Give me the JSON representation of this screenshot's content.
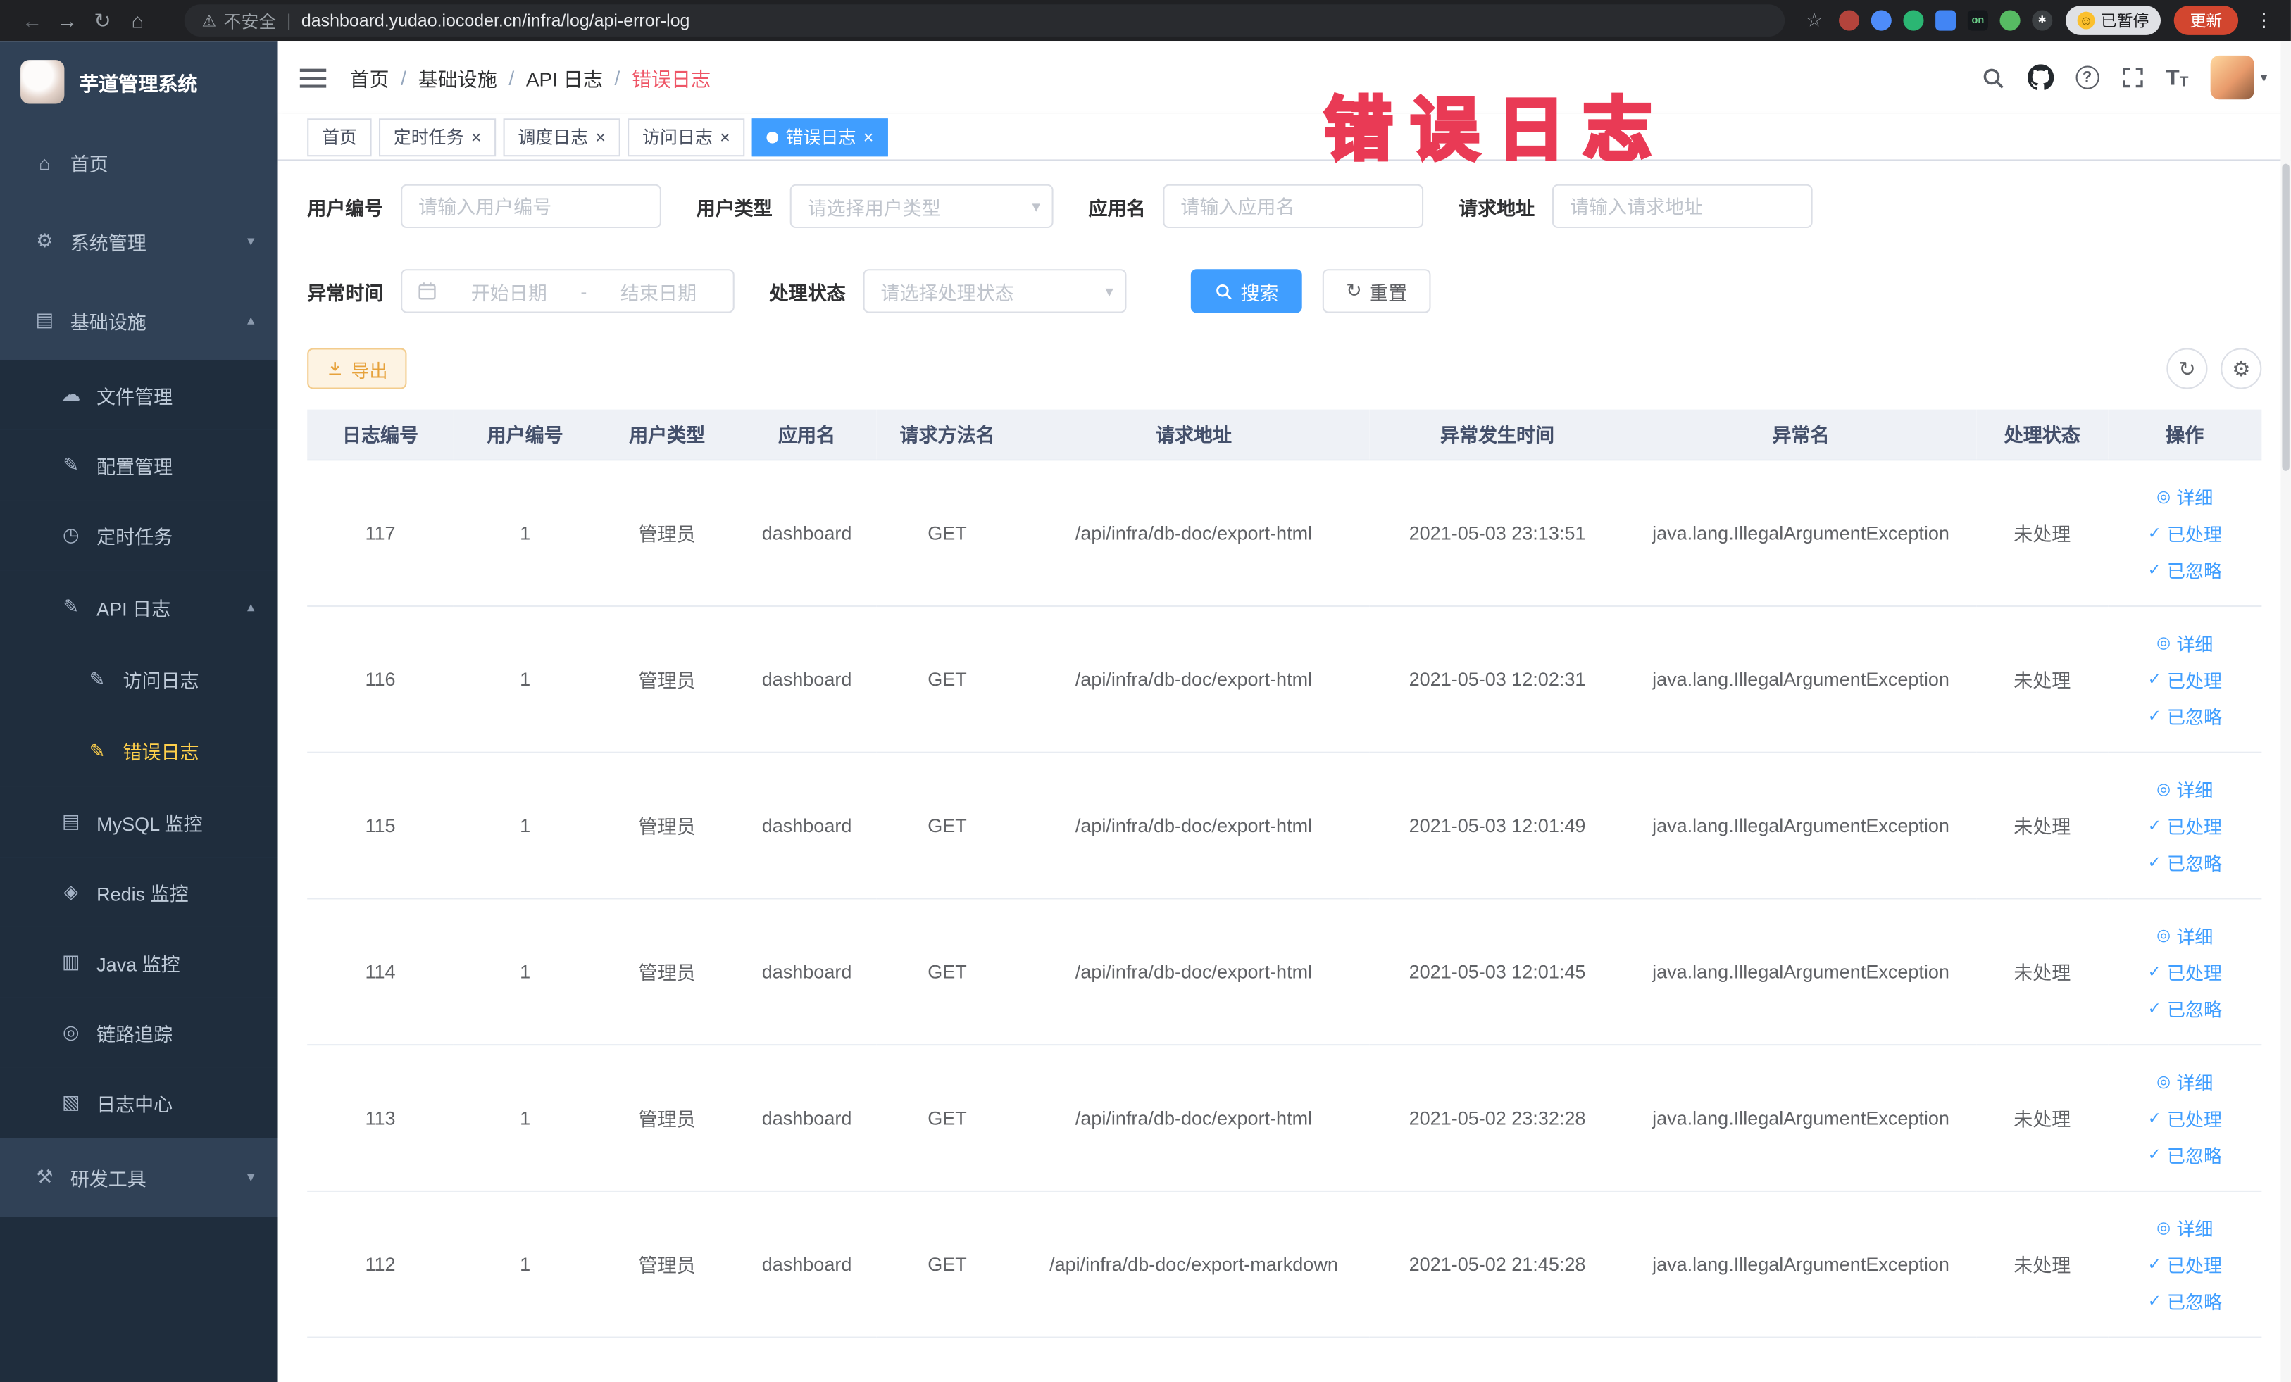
{
  "browser": {
    "security_label": "不安全",
    "url": "dashboard.yudao.iocoder.cn/infra/log/api-error-log",
    "paused_badge": "已暂停",
    "update_button": "更新",
    "extensions": [
      {
        "name": "extension-red-circle-icon",
        "shape": "circle",
        "color": "#b3443c",
        "text": ""
      },
      {
        "name": "extension-blue-drop-icon",
        "shape": "circle",
        "color": "#4e8cf9",
        "text": ""
      },
      {
        "name": "extension-green-circle-icon",
        "shape": "circle",
        "color": "#2bb673",
        "text": ""
      },
      {
        "name": "extension-blue-grid-icon",
        "shape": "square",
        "color": "#4285f4",
        "text": ""
      },
      {
        "name": "extension-on-badge-icon",
        "shape": "square",
        "color": "#15181c",
        "text": "on"
      },
      {
        "name": "extension-green-leaf-icon",
        "shape": "circle",
        "color": "#57bb63",
        "text": ""
      },
      {
        "name": "extension-paw-icon",
        "shape": "circle",
        "color": "#3c4043",
        "text": "✱"
      }
    ]
  },
  "sidebar": {
    "title": "芋道管理系统",
    "items": [
      {
        "label": "首页"
      },
      {
        "label": "系统管理"
      },
      {
        "label": "基础设施",
        "children": [
          {
            "label": "文件管理"
          },
          {
            "label": "配置管理"
          },
          {
            "label": "定时任务"
          },
          {
            "label": "API 日志",
            "children": [
              {
                "label": "访问日志"
              },
              {
                "label": "错误日志",
                "active": true
              }
            ]
          },
          {
            "label": "MySQL 监控"
          },
          {
            "label": "Redis 监控"
          },
          {
            "label": "Java 监控"
          },
          {
            "label": "链路追踪"
          },
          {
            "label": "日志中心"
          }
        ]
      },
      {
        "label": "研发工具"
      }
    ]
  },
  "header": {
    "breadcrumb": [
      "首页",
      "基础设施",
      "API 日志",
      "错误日志"
    ]
  },
  "overlay_title": "错误日志",
  "tags": [
    {
      "label": "首页",
      "closable": false,
      "active": false
    },
    {
      "label": "定时任务",
      "closable": true,
      "active": false
    },
    {
      "label": "调度日志",
      "closable": true,
      "active": false
    },
    {
      "label": "访问日志",
      "closable": true,
      "active": false
    },
    {
      "label": "错误日志",
      "closable": true,
      "active": true
    }
  ],
  "filters": {
    "user_id": {
      "label": "用户编号",
      "placeholder": "请输入用户编号"
    },
    "user_type": {
      "label": "用户类型",
      "placeholder": "请选择用户类型"
    },
    "app_name": {
      "label": "应用名",
      "placeholder": "请输入应用名"
    },
    "request_url": {
      "label": "请求地址",
      "placeholder": "请输入请求地址"
    },
    "exception_time": {
      "label": "异常时间",
      "start_placeholder": "开始日期",
      "separator": "-",
      "end_placeholder": "结束日期"
    },
    "process_status": {
      "label": "处理状态",
      "placeholder": "请选择处理状态"
    },
    "search_label": "搜索",
    "reset_label": "重置"
  },
  "toolbar": {
    "export_label": "导出"
  },
  "table": {
    "columns": [
      "日志编号",
      "用户编号",
      "用户类型",
      "应用名",
      "请求方法名",
      "请求地址",
      "异常发生时间",
      "异常名",
      "处理状态",
      "操作"
    ],
    "row_actions": [
      "详细",
      "已处理",
      "已忽略"
    ],
    "rows": [
      {
        "id": "117",
        "user_id": "1",
        "user_type": "管理员",
        "app": "dashboard",
        "method": "GET",
        "url": "/api/infra/db-doc/export-html",
        "time": "2021-05-03 23:13:51",
        "exception": "java.lang.IllegalArgumentException",
        "status": "未处理"
      },
      {
        "id": "116",
        "user_id": "1",
        "user_type": "管理员",
        "app": "dashboard",
        "method": "GET",
        "url": "/api/infra/db-doc/export-html",
        "time": "2021-05-03 12:02:31",
        "exception": "java.lang.IllegalArgumentException",
        "status": "未处理"
      },
      {
        "id": "115",
        "user_id": "1",
        "user_type": "管理员",
        "app": "dashboard",
        "method": "GET",
        "url": "/api/infra/db-doc/export-html",
        "time": "2021-05-03 12:01:49",
        "exception": "java.lang.IllegalArgumentException",
        "status": "未处理"
      },
      {
        "id": "114",
        "user_id": "1",
        "user_type": "管理员",
        "app": "dashboard",
        "method": "GET",
        "url": "/api/infra/db-doc/export-html",
        "time": "2021-05-03 12:01:45",
        "exception": "java.lang.IllegalArgumentException",
        "status": "未处理"
      },
      {
        "id": "113",
        "user_id": "1",
        "user_type": "管理员",
        "app": "dashboard",
        "method": "GET",
        "url": "/api/infra/db-doc/export-html",
        "time": "2021-05-02 23:32:28",
        "exception": "java.lang.IllegalArgumentException",
        "status": "未处理"
      },
      {
        "id": "112",
        "user_id": "1",
        "user_type": "管理员",
        "app": "dashboard",
        "method": "GET",
        "url": "/api/infra/db-doc/export-markdown",
        "time": "2021-05-02 21:45:28",
        "exception": "java.lang.IllegalArgumentException",
        "status": "未处理"
      }
    ]
  },
  "icons": {
    "back": "←",
    "forward": "→",
    "reload": "↻",
    "home": "⌂",
    "warning": "⚠",
    "star": "☆",
    "dots": "⋮",
    "smile": "☺",
    "close": "×",
    "caret_down": "▾",
    "caret_up": "▴",
    "help": "?",
    "letter_t": "T",
    "home_menu": "⌂",
    "gear": "⚙",
    "infra": "▤",
    "file": "☁",
    "config": "✎",
    "cron": "◷",
    "apilog": "✎",
    "doc": "✎",
    "mysql": "▤",
    "redis": "◈",
    "java": "▥",
    "trace": "◎",
    "logcenter": "▧",
    "tools": "⚒",
    "eye": "◎",
    "check": "✓",
    "refresh": "↻",
    "settings": "⚙"
  },
  "colors": {
    "accent": "#409eff",
    "sidebar_bg": "#304156",
    "submenu_bg": "#1f2d3d",
    "active_menu": "#ffd04b",
    "warning": "#e6a23c",
    "overlay_annotation": "#e93a55",
    "table_header_bg": "#eef1f6"
  }
}
